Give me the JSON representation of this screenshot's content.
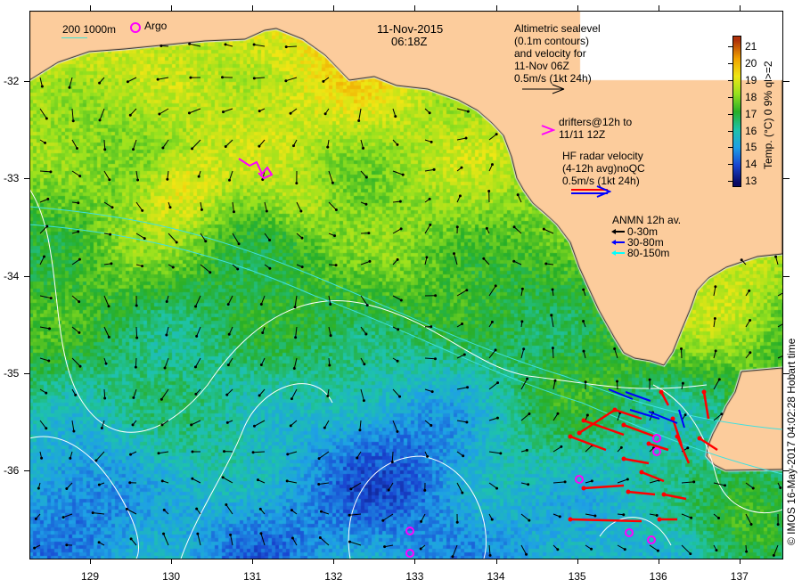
{
  "title": {
    "date": "11-Nov-2015",
    "time": "06:18Z"
  },
  "legend": {
    "isobath": "200  1000m",
    "argo": "Argo",
    "altimetry": [
      "Altimetric sealevel",
      "(0.1m contours)",
      "and velocity for",
      "11-Nov 06Z",
      "0.5m/s (1kt 24h)"
    ],
    "drifters": [
      "drifters@12h to",
      "11/11 12Z"
    ],
    "hf_radar": [
      "HF radar velocity",
      "(4-12h avg)noQC",
      "0.5m/s (1kt 24h)"
    ],
    "anmn": {
      "title": "ANMN 12h av.",
      "items": [
        "0-30m",
        "30-80m",
        "80-150m"
      ]
    }
  },
  "axes": {
    "x_ticks": [
      "129",
      "130",
      "131",
      "132",
      "133",
      "134",
      "135",
      "136",
      "137"
    ],
    "y_ticks": [
      "-32",
      "-33",
      "-34",
      "-35",
      "-36"
    ]
  },
  "colorbar": {
    "label": "Temp. (°C) 0 9% ql>=2",
    "ticks": [
      "21",
      "20",
      "19",
      "18",
      "17",
      "16",
      "15",
      "14",
      "13"
    ],
    "range": [
      13,
      21
    ]
  },
  "credit": "© IMOS 16-May-2017 04:02:28 Hobart time",
  "colors": {
    "land": "#fccc9c",
    "argo": "#ff00ff",
    "hf_radar": "#ff0000",
    "anmn_mid": "#0000ff",
    "anmn_deep": "#00ffff"
  }
}
